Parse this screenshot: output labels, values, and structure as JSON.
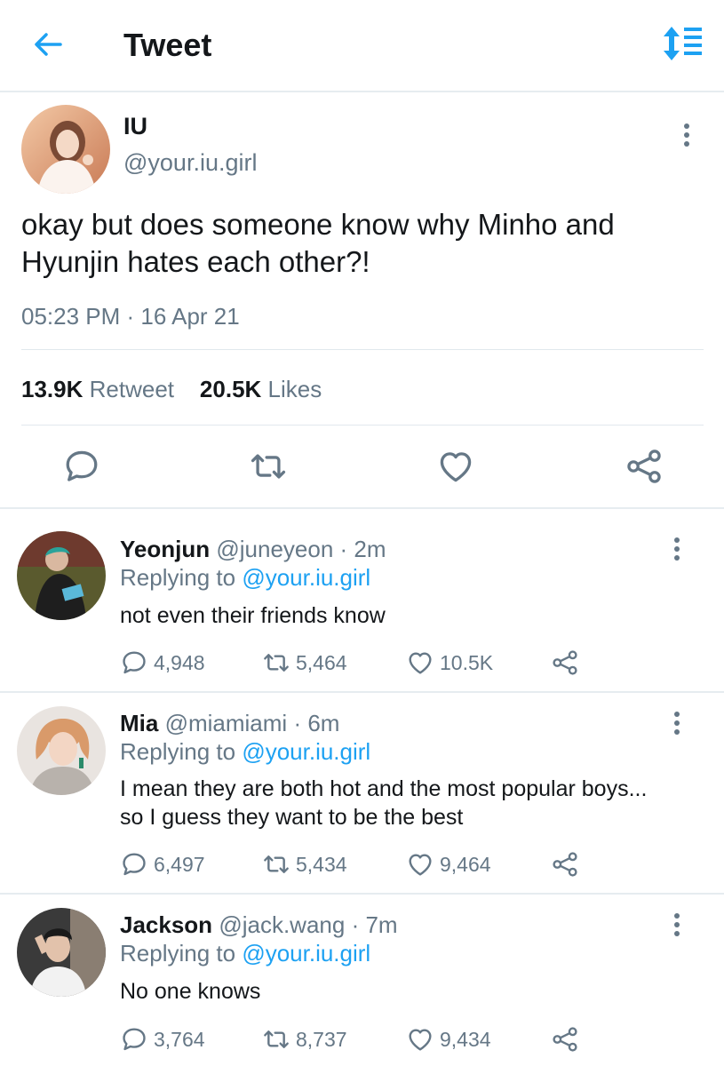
{
  "header": {
    "title": "Tweet"
  },
  "tweet": {
    "name": "IU",
    "handle": "@your.iu.girl",
    "text": "okay but does someone know why Minho and Hyunjin hates each other?!",
    "time": "05:23 PM · 16 Apr 21",
    "retweets_count": "13.9K",
    "retweets_label": "Retweet",
    "likes_count": "20.5K",
    "likes_label": "Likes"
  },
  "replies": [
    {
      "name": "Yeonjun",
      "handle": "@juneyeon",
      "time": "· 2m",
      "replying_label": "Replying to",
      "replying_to": "@your.iu.girl",
      "text": "not even their friends know",
      "comments": "4,948",
      "retweets": "5,464",
      "likes": "10.5K"
    },
    {
      "name": "Mia",
      "handle": "@miamiami",
      "time": "· 6m",
      "replying_label": "Replying to",
      "replying_to": "@your.iu.girl",
      "text": "I mean they are both hot and the most popular boys... so I guess they want to be the best",
      "comments": "6,497",
      "retweets": "5,434",
      "likes": "9,464"
    },
    {
      "name": "Jackson",
      "handle": "@jack.wang",
      "time": "· 7m",
      "replying_label": "Replying to",
      "replying_to": "@your.iu.girl",
      "text": "No one knows",
      "comments": "3,764",
      "retweets": "8,737",
      "likes": "9,434"
    }
  ],
  "colors": {
    "accent": "#1da1f2",
    "secondary_text": "#657786",
    "primary_text": "#14171a",
    "divider": "#e6ecf0"
  },
  "icons": [
    "back-arrow-icon",
    "sort-icon",
    "more-icon",
    "reply-icon",
    "retweet-icon",
    "like-icon",
    "share-icon"
  ]
}
